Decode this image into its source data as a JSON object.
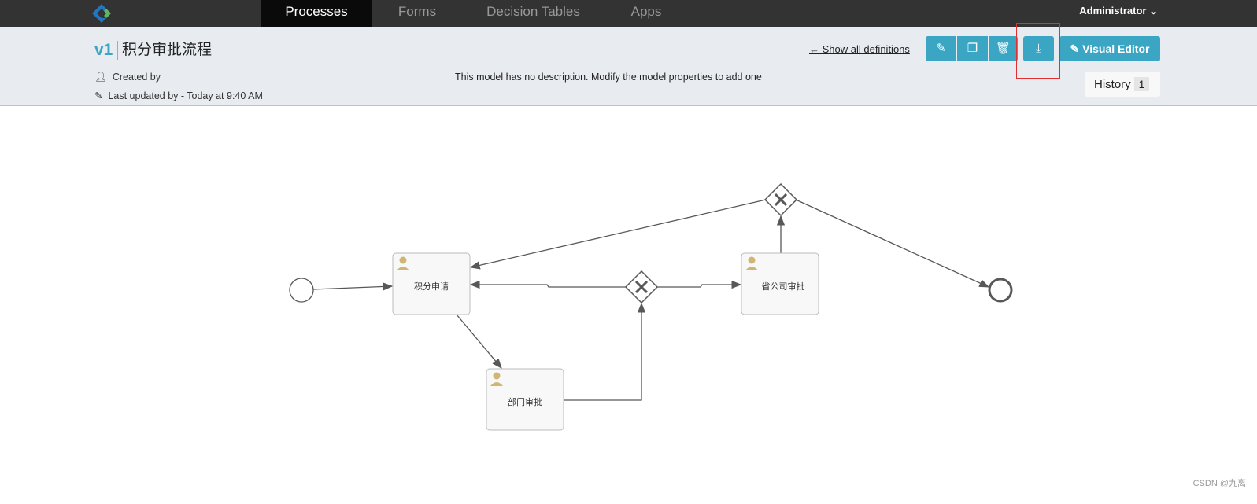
{
  "nav": {
    "tabs": [
      {
        "label": "Processes",
        "active": true
      },
      {
        "label": "Forms"
      },
      {
        "label": "Decision Tables"
      },
      {
        "label": "Apps"
      }
    ],
    "user": "Administrator"
  },
  "model": {
    "version": "v1",
    "name": "积分审批流程",
    "created_by": "Created by",
    "last_updated": "Last updated by - Today at 9:40 AM",
    "description": "This model has no description. Modify the model properties to add one"
  },
  "actions": {
    "show_all": "← Show all definitions",
    "visual_editor": "Visual Editor",
    "history_label": "History",
    "history_count": "1"
  },
  "diagram": {
    "tasks": [
      "积分申请",
      "部门审批",
      "省公司审批"
    ]
  },
  "watermark": "CSDN @九离",
  "colors": {
    "accent": "#3aa6c4",
    "nav": "#333333",
    "header": "#e8ecf0"
  }
}
